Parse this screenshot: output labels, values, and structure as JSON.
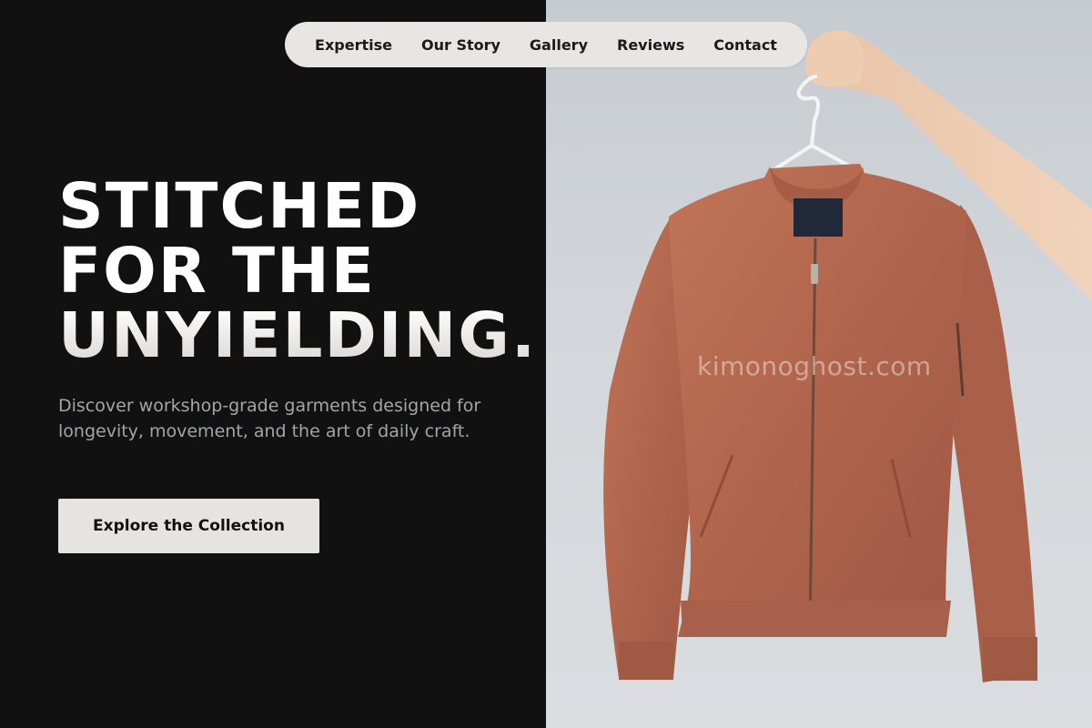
{
  "nav": {
    "items": [
      {
        "label": "Expertise"
      },
      {
        "label": "Our Story"
      },
      {
        "label": "Gallery"
      },
      {
        "label": "Reviews"
      },
      {
        "label": "Contact"
      }
    ]
  },
  "hero": {
    "title_lines": [
      "STITCHED",
      "FOR THE",
      "UNYIELDING."
    ],
    "subtitle": "Discover workshop-grade garments designed for longevity, movement, and the art of daily craft.",
    "cta_label": "Explore the Collection"
  },
  "product_image": {
    "subject": "rust-colored bomber jacket on hanger held by hand",
    "watermark": "kimonoghost.com"
  },
  "colors": {
    "background": "#111111",
    "nav_pill": "#e8e6e3",
    "cta_button": "#e6e4e1",
    "jacket": "#b56a52",
    "photo_background": "#d3d7db"
  }
}
